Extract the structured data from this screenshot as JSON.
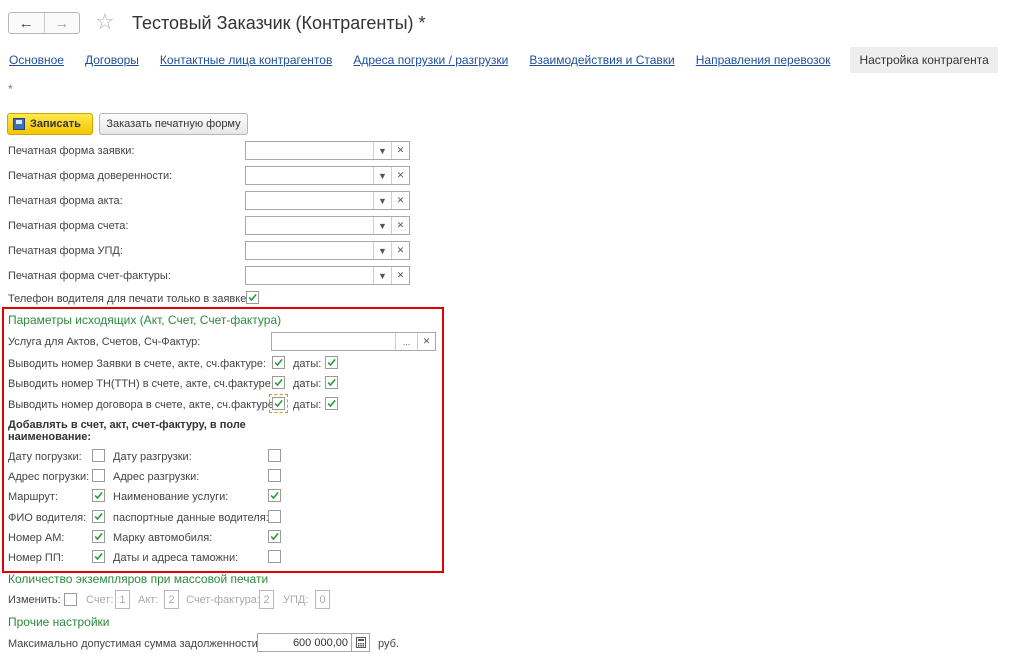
{
  "window": {
    "title": "Тестовый Заказчик (Контрагенты) *",
    "modified_marker": "*"
  },
  "tabs": [
    {
      "label": "Основное"
    },
    {
      "label": "Договоры"
    },
    {
      "label": "Контактные лица контрагентов"
    },
    {
      "label": "Адреса погрузки / разгрузки"
    },
    {
      "label": "Взаимодействия и Ставки"
    },
    {
      "label": "Направления перевозок"
    },
    {
      "label": "Настройка контрагента",
      "active": true
    }
  ],
  "toolbar": {
    "save_label": "Записать",
    "print_label": "Заказать печатную форму"
  },
  "print_forms": [
    {
      "label": "Печатная форма заявки:",
      "value": ""
    },
    {
      "label": "Печатная форма доверенности:",
      "value": ""
    },
    {
      "label": "Печатная форма акта:",
      "value": ""
    },
    {
      "label": "Печатная форма счета:",
      "value": ""
    },
    {
      "label": "Печатная форма УПД:",
      "value": ""
    },
    {
      "label": "Печатная форма счет-фактуры:",
      "value": ""
    }
  ],
  "driver_phone": {
    "label": "Телефон водителя для печати только в заявке:",
    "checked": true
  },
  "outgoing": {
    "title": "Параметры исходящих (Акт, Счет, Счет-фактура)",
    "service_label": "Услуга для Актов, Счетов, Сч-Фактур:",
    "service_value": "",
    "service_select": "...",
    "rows": [
      {
        "label": "Выводить номер Заявки в счете, акте, сч.фактуре:",
        "checked": true,
        "date_label": "даты:",
        "date_checked": true
      },
      {
        "label": "Выводить номер ТН(ТТН) в счете, акте, сч.фактуре:",
        "checked": true,
        "date_label": "даты:",
        "date_checked": true
      },
      {
        "label": "Выводить номер договора в счете, акте, сч.фактуре:",
        "checked": true,
        "date_label": "даты:",
        "date_checked": true
      }
    ],
    "add_title_line1": "Добавлять в счет, акт, счет-фактуру, в поле",
    "add_title_line2": "наименование:",
    "left_items": [
      {
        "label": "Дату погрузки:",
        "checked": false
      },
      {
        "label": "Адрес погрузки:",
        "checked": false
      },
      {
        "label": "Маршрут:",
        "checked": true
      },
      {
        "label": "ФИО водителя:",
        "checked": true
      },
      {
        "label": "Номер АМ:",
        "checked": true
      },
      {
        "label": "Номер ПП:",
        "checked": true
      }
    ],
    "right_items": [
      {
        "label": "Дату разгрузки:",
        "checked": false
      },
      {
        "label": "Адрес разгрузки:",
        "checked": false
      },
      {
        "label": "Наименование услуги:",
        "checked": true
      },
      {
        "label": "паспортные данные водителя:",
        "checked": false
      },
      {
        "label": "Марку автомобиля:",
        "checked": true
      },
      {
        "label": "Даты и адреса таможни:",
        "checked": false
      }
    ]
  },
  "copies": {
    "title": "Количество экземпляров при массовой печати",
    "change_label": "Изменить:",
    "change_checked": false,
    "items": [
      {
        "label": "Счет:",
        "value": "1"
      },
      {
        "label": "Акт:",
        "value": "2"
      },
      {
        "label": "Счет-фактура:",
        "value": "2"
      },
      {
        "label": "УПД:",
        "value": "0"
      }
    ]
  },
  "other": {
    "title": "Прочие настройки",
    "debt_label": "Максимально допустимая сумма задолженности:",
    "debt_value": "600 000,00",
    "currency": "руб."
  },
  "colors": {
    "section": "#2a8a3c",
    "highlight": "#e00000",
    "save_button": "#f3c600",
    "link": "#1d4e9c",
    "check": "#2a9a3a"
  }
}
